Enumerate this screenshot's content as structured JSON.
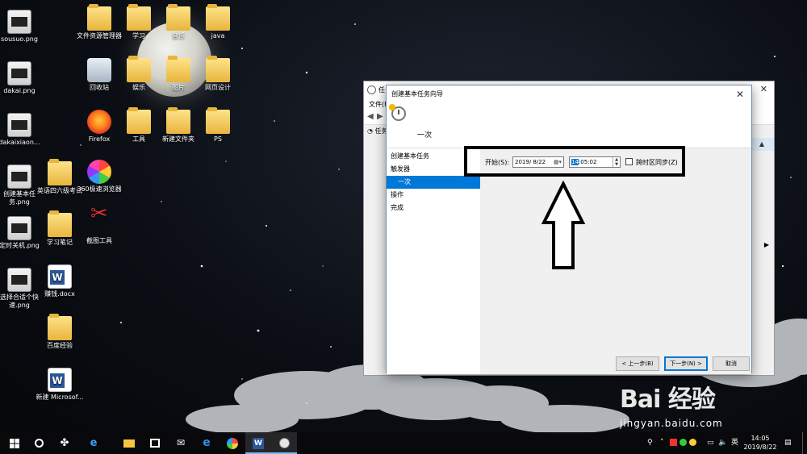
{
  "desktop": {
    "icons": [
      {
        "label": "sousuo.png"
      },
      {
        "label": "dakai.png"
      },
      {
        "label": "dakaixiaon..."
      },
      {
        "label": "创建基本任务.png"
      },
      {
        "label": "定时关机.png"
      },
      {
        "label": "选择合适个快速.png"
      },
      {
        "label": "英语四六级考试"
      },
      {
        "label": "学习笔记"
      },
      {
        "label": "赚钱.docx"
      },
      {
        "label": "百度经验"
      },
      {
        "label": "新建 Microsof..."
      },
      {
        "label": "文件资源管理器"
      },
      {
        "label": "回收站"
      },
      {
        "label": "Firefox"
      },
      {
        "label": "360极速浏览器"
      },
      {
        "label": "截图工具"
      },
      {
        "label": "学习"
      },
      {
        "label": "娱乐"
      },
      {
        "label": "工具"
      },
      {
        "label": "音乐"
      },
      {
        "label": "图片"
      },
      {
        "label": "新建文件夹"
      },
      {
        "label": "java"
      },
      {
        "label": "网页设计"
      },
      {
        "label": "PS"
      }
    ]
  },
  "background_window": {
    "title": "任",
    "menu": "文件(F)",
    "tree_item": "任务"
  },
  "dialog": {
    "title": "创建基本任务向导",
    "header_title": "一次",
    "nav": [
      {
        "label": "创建基本任务"
      },
      {
        "label": "触发器"
      },
      {
        "label": "一次"
      },
      {
        "label": "操作"
      },
      {
        "label": "完成"
      }
    ],
    "start_label": "开始(S):",
    "date_value": "2019/ 8/22",
    "time_hour": "14",
    "time_rest": ":05:02",
    "sync_label": "跨时区同步(Z)",
    "buttons": {
      "back": "< 上一步(B)",
      "next": "下一步(N) >",
      "cancel": "取消"
    }
  },
  "watermark": {
    "logo": "Bai  经验",
    "url": "jingyan.baidu.com"
  },
  "taskbar": {
    "time": "14:05",
    "date": "2019/8/22"
  },
  "colors": {
    "accent": "#0078d7",
    "taskbar": "#0a0a0c"
  }
}
